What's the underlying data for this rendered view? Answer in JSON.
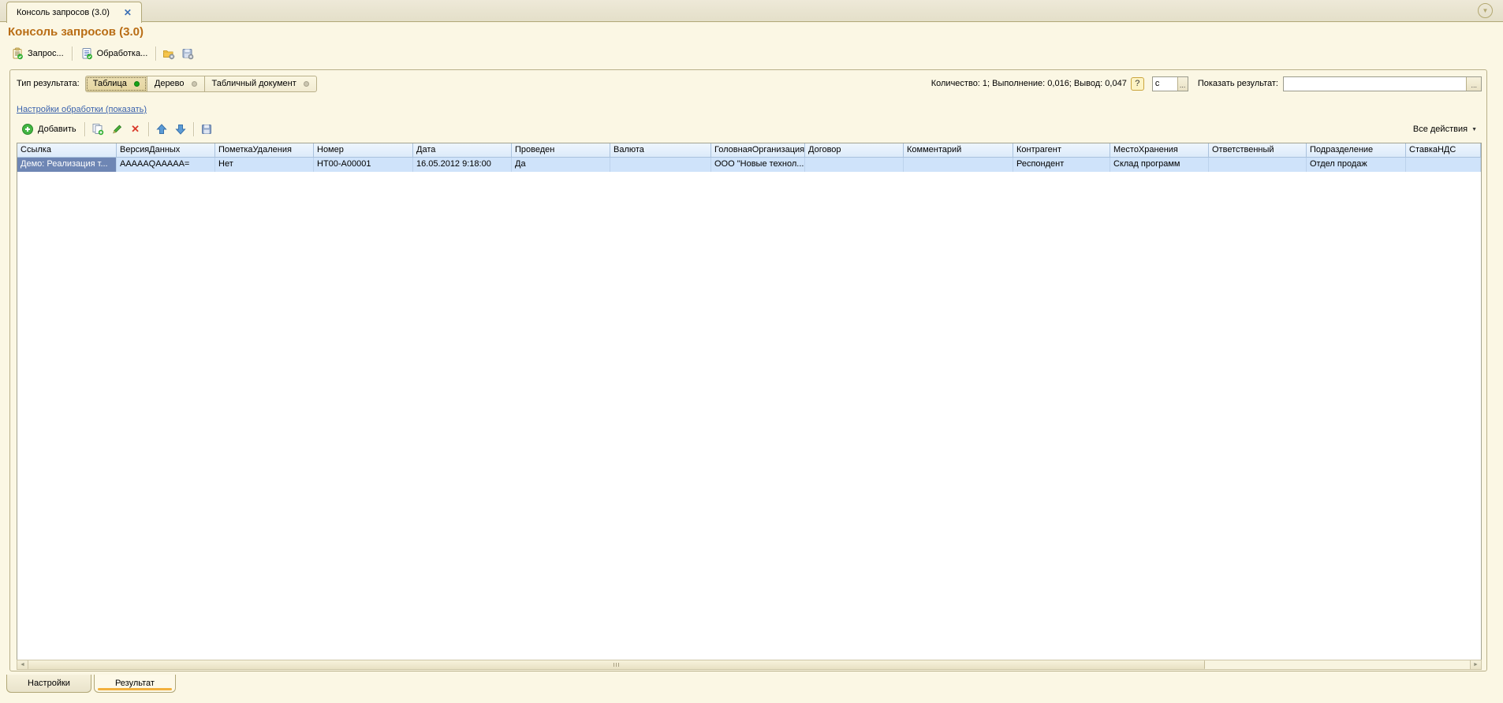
{
  "icons": {
    "close": "✕",
    "collapse": "▼",
    "dropdown": "▼",
    "help": "?",
    "ellipsis": "...",
    "scroll_left": "◄",
    "scroll_right": "►",
    "delete": "✕"
  },
  "window_tab": {
    "label": "Консоль запросов (3.0)"
  },
  "header": {
    "title": "Консоль запросов (3.0)"
  },
  "toolbar": {
    "query": "Запрос...",
    "processing": "Обработка..."
  },
  "result_bar": {
    "type_label": "Тип результата:",
    "types": [
      {
        "label": "Таблица",
        "selected": true
      },
      {
        "label": "Дерево",
        "selected": false
      },
      {
        "label": "Табличный документ",
        "selected": false
      }
    ],
    "stats": "Количество: 1; Выполнение: 0,016; Вывод: 0,047",
    "from_value": "с",
    "show_result_label": "Показать результат:",
    "show_result_value": ""
  },
  "settings_link": "Настройки обработки (показать)",
  "grid_toolbar": {
    "add": "Добавить",
    "all_actions": "Все действия"
  },
  "table": {
    "columns": [
      "Ссылка",
      "ВерсияДанных",
      "ПометкаУдаления",
      "Номер",
      "Дата",
      "Проведен",
      "Валюта",
      "ГоловнаяОрганизация",
      "Договор",
      "Комментарий",
      "Контрагент",
      "МестоХранения",
      "Ответственный",
      "Подразделение",
      "СтавкаНДС"
    ],
    "rows": [
      [
        "Демо: Реализация т...",
        "AAAAAQAAAAA=",
        "Нет",
        "НТ00-А00001",
        "16.05.2012 9:18:00",
        "Да",
        "",
        "ООО \"Новые технол...",
        "",
        "",
        "Респондент",
        "Склад программ",
        "",
        "Отдел продаж",
        ""
      ]
    ]
  },
  "bottom_tabs": [
    {
      "label": "Настройки",
      "active": false
    },
    {
      "label": "Результат",
      "active": true
    }
  ],
  "colors": {
    "title": "#b96d15",
    "selected_row": "#cfe3fa",
    "current_cell": "#6e86b4",
    "active_tab_marker": "#f2b13e",
    "link": "#3a62ad"
  }
}
